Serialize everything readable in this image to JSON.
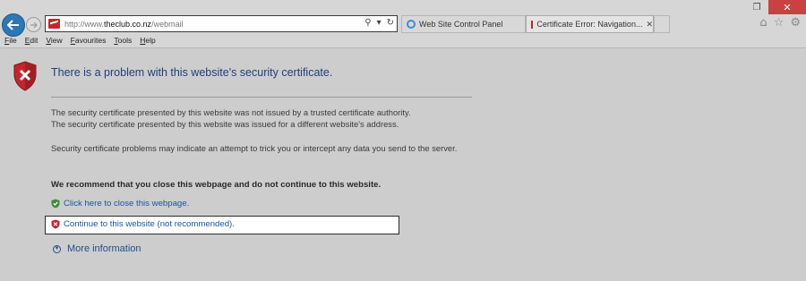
{
  "browser": {
    "address": {
      "url_prefix": "http://www.",
      "url_domain": "theclub.co.nz",
      "url_path": "/webmail",
      "search_glyph": "⚲",
      "dropdown_glyph": "▾",
      "refresh_glyph": "↻"
    },
    "tabs": [
      {
        "label": "Web Site Control Panel",
        "icon": "ie-icon"
      },
      {
        "label": "Certificate Error: Navigation...",
        "icon": "cert-error-icon",
        "close": "✕"
      }
    ],
    "window_controls": {
      "restore": "❐",
      "close": "✕"
    },
    "right_icons": {
      "home": "⌂",
      "favorites": "☆",
      "settings": "⚙"
    },
    "menu": [
      "File",
      "Edit",
      "View",
      "Favourites",
      "Tools",
      "Help"
    ]
  },
  "page": {
    "heading": "There is a problem with this website's security certificate.",
    "paragraph1_line1": "The security certificate presented by this website was not issued by a trusted certificate authority.",
    "paragraph1_line2": "The security certificate presented by this website was issued for a different website's address.",
    "paragraph2": "Security certificate problems may indicate an attempt to trick you or intercept any data you send to the server.",
    "recommendation": "We recommend that you close this webpage and do not continue to this website.",
    "close_link": "Click here to close this webpage.",
    "continue_link": "Continue to this website (not recommended).",
    "more_info": "More information"
  },
  "colors": {
    "heading": "#1f3f7c",
    "link": "#1a55a5",
    "shield_red": "#c0272d",
    "shield_green": "#3f8c3a",
    "close_button": "#c94141"
  }
}
